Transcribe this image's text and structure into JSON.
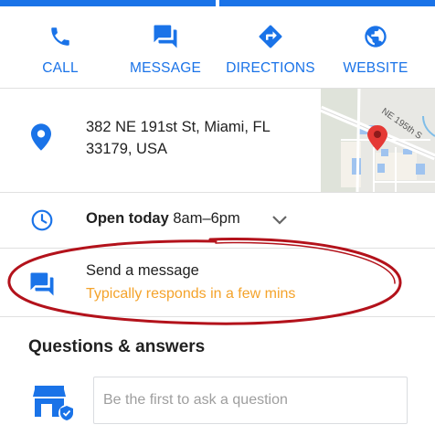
{
  "actions": [
    {
      "label": "CALL",
      "icon": "phone-icon"
    },
    {
      "label": "MESSAGE",
      "icon": "chat-icon"
    },
    {
      "label": "DIRECTIONS",
      "icon": "directions-icon"
    },
    {
      "label": "WEBSITE",
      "icon": "globe-icon"
    }
  ],
  "address": {
    "line1": "382 NE 191st St, Miami, FL",
    "line2": "33179, USA",
    "map_street_label": "NE 195th S"
  },
  "hours": {
    "status": "Open today",
    "time": "8am–6pm"
  },
  "message": {
    "title": "Send a message",
    "subtitle": "Typically responds in a few mins"
  },
  "qa": {
    "title": "Questions & answers",
    "placeholder": "Be the first to ask a question"
  },
  "colors": {
    "accent_blue": "#1a73e8",
    "responds_orange": "#f4a32b",
    "annotation_red": "#b3121b"
  }
}
